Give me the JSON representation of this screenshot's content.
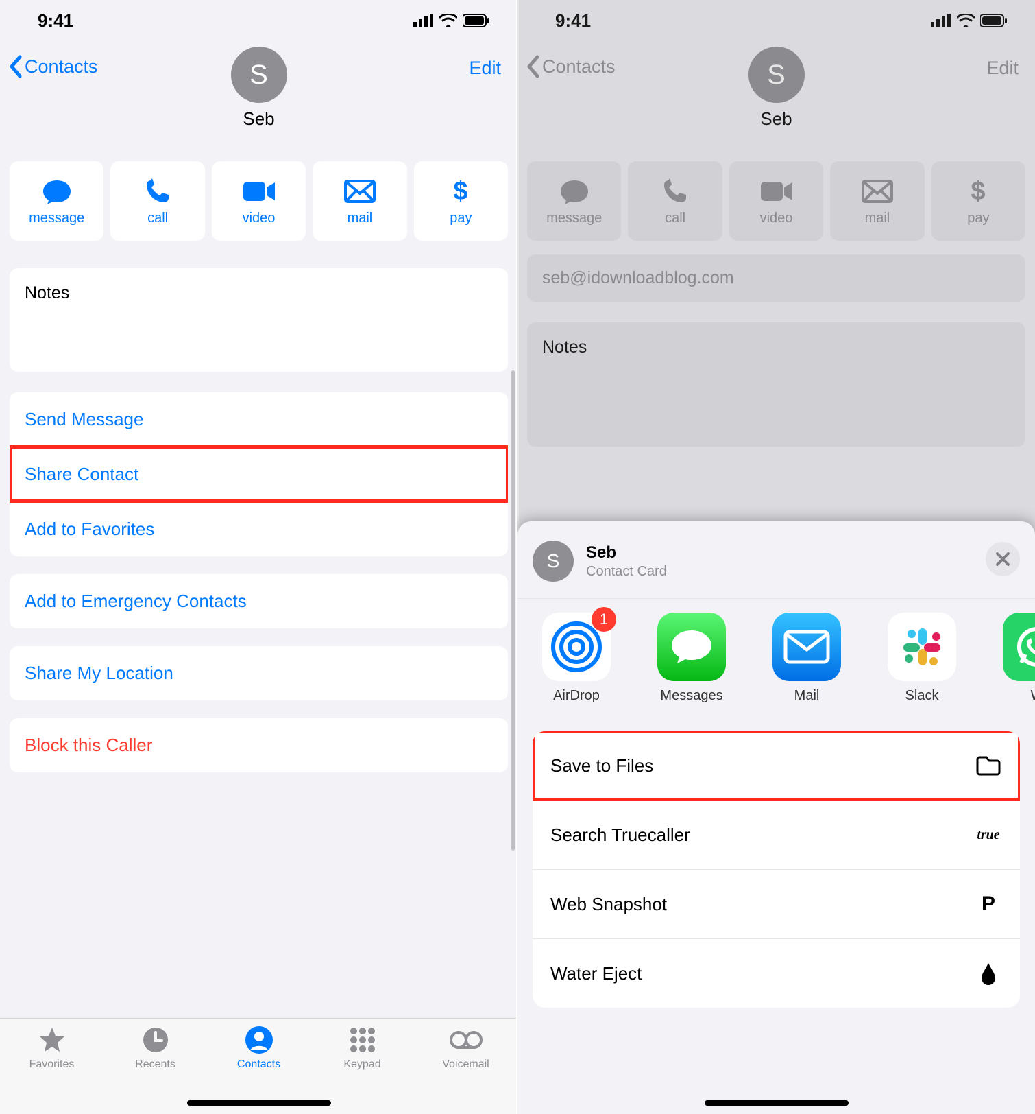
{
  "status": {
    "time": "9:41"
  },
  "nav": {
    "back": "Contacts",
    "edit": "Edit"
  },
  "contact": {
    "initial": "S",
    "name": "Seb",
    "email": "seb@idownloadblog.com"
  },
  "actions": {
    "message": "message",
    "call": "call",
    "video": "video",
    "mail": "mail",
    "pay": "pay"
  },
  "notes_label": "Notes",
  "list": {
    "send_message": "Send Message",
    "share_contact": "Share Contact",
    "add_favorites": "Add to Favorites",
    "add_emergency": "Add to Emergency Contacts",
    "share_location": "Share My Location",
    "block": "Block this Caller"
  },
  "tabs": {
    "favorites": "Favorites",
    "recents": "Recents",
    "contacts": "Contacts",
    "keypad": "Keypad",
    "voicemail": "Voicemail"
  },
  "share": {
    "title": "Seb",
    "subtitle": "Contact Card",
    "apps": {
      "airdrop": "AirDrop",
      "airdrop_badge": "1",
      "messages": "Messages",
      "mail": "Mail",
      "slack": "Slack",
      "whatsapp": "W"
    },
    "actions": {
      "save_files": "Save to Files",
      "truecaller": "Search Truecaller",
      "truecaller_icon_text": "true",
      "web_snapshot": "Web Snapshot",
      "water_eject": "Water Eject"
    }
  }
}
